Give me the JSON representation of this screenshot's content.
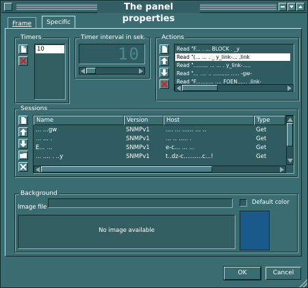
{
  "window": {
    "title": "The panel properties"
  },
  "tabs": [
    {
      "label": "Frame",
      "active": false
    },
    {
      "label": "Specific",
      "active": true
    }
  ],
  "timers": {
    "title": "Timers",
    "items": [
      "10"
    ]
  },
  "timer_interval": {
    "title": "Timer interval in sek.",
    "display": "10"
  },
  "actions": {
    "title": "Actions",
    "rows": [
      {
        "text": "Read \"F... . ... BLOCK . _y",
        "selected": false
      },
      {
        "text": "Read \"(... ... . _ y_link-...    ,link",
        "selected": true
      },
      {
        "text": "Read \"......... ... ... . y_link-.....",
        "selected": false
      },
      {
        "text": "Read \"... .... .. .......... ..... -gw-",
        "selected": false
      },
      {
        "text": "Read \"F...........  ....  FOEN...... .link-",
        "selected": false
      }
    ]
  },
  "sessions": {
    "title": "Sessions",
    "columns": [
      "Name",
      "Version",
      "Host",
      "Type"
    ],
    "rows": [
      {
        "name": "... ...gw",
        "version": "SNMPv1",
        "host": "....  ... ......  ... ..",
        "type": "Get"
      },
      {
        "name": "... ... .",
        "version": "SNMPv1",
        "host": "...  ..  ..... .",
        "type": "Get"
      },
      {
        "name": "E... ...",
        "version": "SNMPv1",
        "host": "e-c... ... ...",
        "type": "Get"
      },
      {
        "name": "... .... . ..y",
        "version": "SNMPv1",
        "host": "t..dz-c..........c...!",
        "type": "Get"
      }
    ]
  },
  "background": {
    "title": "Background",
    "image_file_label": "Image file",
    "image_file_value": "",
    "default_color_label": "Default color",
    "default_color_checked": false,
    "preview_text": "No image available",
    "swatch_color": "#1a5a8a"
  },
  "buttons": {
    "ok": "OK",
    "cancel": "Cancel"
  }
}
